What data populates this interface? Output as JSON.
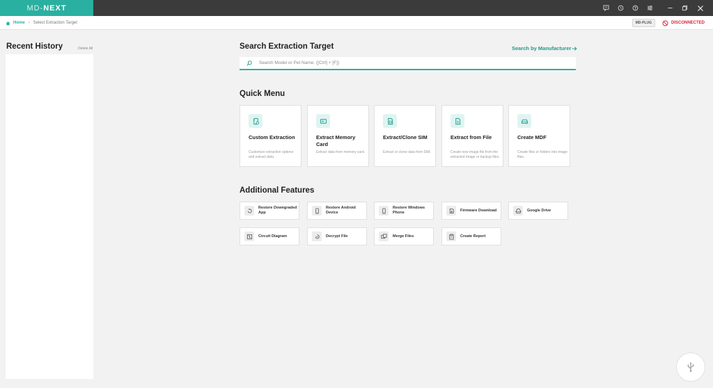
{
  "app": {
    "brand_prefix": "MD-",
    "brand_suffix": "NEXT"
  },
  "window_icons": [
    "feedback-icon",
    "history-icon",
    "help-icon",
    "settings-icon",
    "minimize-icon",
    "restore-icon",
    "close-icon"
  ],
  "breadcrumb": {
    "home": "Home",
    "current": "Select Extraction Target"
  },
  "status": {
    "device": "MD-PLUG",
    "connection": "DISCONNECTED",
    "connection_color": "#d7263d"
  },
  "sidebar": {
    "title": "Recent History",
    "delete_all": "Delete All"
  },
  "search": {
    "title": "Search Extraction Target",
    "by_manufacturer": "Search by Manufacturer",
    "placeholder": "Search Model or Pet Name. ([Ctrl] + [F])"
  },
  "quick_menu": {
    "title": "Quick Menu",
    "items": [
      {
        "title": "Custom Extraction",
        "desc": "Customize extraction options and extract data.",
        "icon": "custom-extraction-icon"
      },
      {
        "title": "Extract Memory Card",
        "desc": "Extract data from memory card.",
        "icon": "memory-card-icon"
      },
      {
        "title": "Extract/Clone SIM",
        "desc": "Extract or clone data from SIM.",
        "icon": "sim-card-icon"
      },
      {
        "title": "Extract from File",
        "desc": "Create new image file from the extracted image or backup files.",
        "icon": "file-icon"
      },
      {
        "title": "Create MDF",
        "desc": "Create files or folders into image files.",
        "icon": "drive-icon"
      }
    ]
  },
  "additional": {
    "title": "Additional Features",
    "items": [
      {
        "label": "Restore Downgraded App",
        "icon": "restore-icon"
      },
      {
        "label": "Restore Android Device",
        "icon": "phone-icon"
      },
      {
        "label": "Restore Windows Phone",
        "icon": "phone-icon"
      },
      {
        "label": "Firmware Download",
        "icon": "download-icon"
      },
      {
        "label": "Google Drive",
        "icon": "google-drive-icon"
      },
      {
        "label": "Circuit Diagram",
        "icon": "circuit-icon"
      },
      {
        "label": "Decrypt File",
        "icon": "decrypt-icon"
      },
      {
        "label": "Merge Files",
        "icon": "merge-icon"
      },
      {
        "label": "Create Report",
        "icon": "report-icon"
      }
    ]
  },
  "colors": {
    "accent": "#2ab0a0",
    "titlebar": "#3b3b3b",
    "background": "#f2f2f2"
  }
}
